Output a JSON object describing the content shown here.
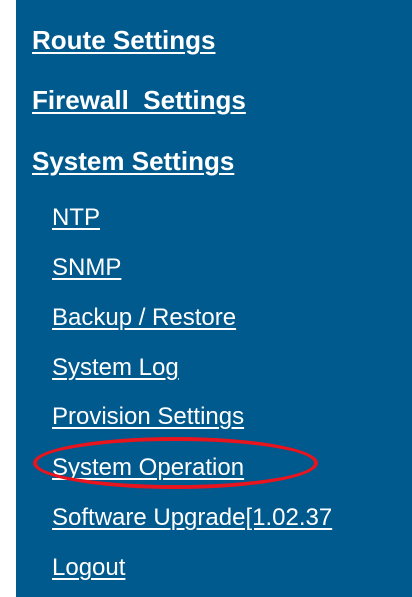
{
  "nav": {
    "top_items": [
      {
        "label": "Route Settings"
      },
      {
        "label": "Firewall  Settings"
      },
      {
        "label": "System Settings"
      }
    ],
    "sub_items": [
      {
        "label": "NTP"
      },
      {
        "label": "SNMP"
      },
      {
        "label": "Backup / Restore"
      },
      {
        "label": "System Log"
      },
      {
        "label": "Provision Settings"
      },
      {
        "label": "System Operation",
        "highlighted": true
      },
      {
        "label": "Software Upgrade[1.02.37"
      },
      {
        "label": "Logout"
      }
    ]
  },
  "colors": {
    "panel_background": "#005a8e",
    "link_text": "#ffffff",
    "highlight": "#e8141e"
  }
}
